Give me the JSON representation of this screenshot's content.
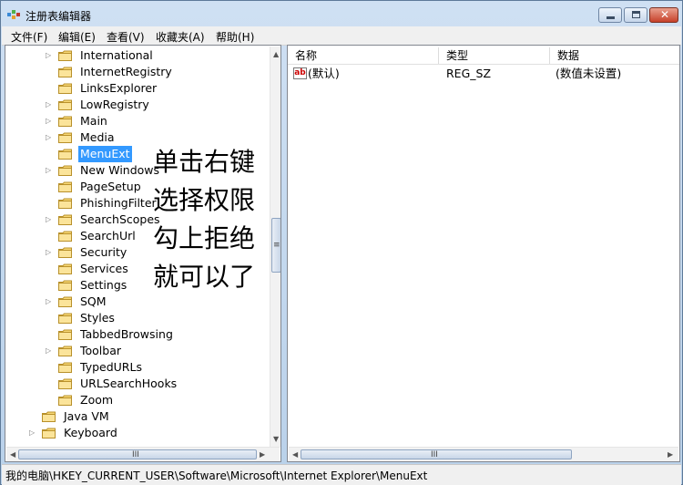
{
  "window": {
    "title": "注册表编辑器"
  },
  "menu": [
    "文件(F)",
    "编辑(E)",
    "查看(V)",
    "收藏夹(A)",
    "帮助(H)"
  ],
  "tree": [
    {
      "label": "International",
      "expander": true
    },
    {
      "label": "InternetRegistry",
      "expander": false
    },
    {
      "label": "LinksExplorer",
      "expander": false
    },
    {
      "label": "LowRegistry",
      "expander": true
    },
    {
      "label": "Main",
      "expander": true
    },
    {
      "label": "Media",
      "expander": true
    },
    {
      "label": "MenuExt",
      "expander": false,
      "selected": true
    },
    {
      "label": "New Windows",
      "expander": true
    },
    {
      "label": "PageSetup",
      "expander": false
    },
    {
      "label": "PhishingFilter",
      "expander": false
    },
    {
      "label": "SearchScopes",
      "expander": true
    },
    {
      "label": "SearchUrl",
      "expander": false
    },
    {
      "label": "Security",
      "expander": true
    },
    {
      "label": "Services",
      "expander": false
    },
    {
      "label": "Settings",
      "expander": false
    },
    {
      "label": "SQM",
      "expander": true
    },
    {
      "label": "Styles",
      "expander": false
    },
    {
      "label": "TabbedBrowsing",
      "expander": false
    },
    {
      "label": "Toolbar",
      "expander": true
    },
    {
      "label": "TypedURLs",
      "expander": false
    },
    {
      "label": "URLSearchHooks",
      "expander": false
    },
    {
      "label": "Zoom",
      "expander": false
    },
    {
      "label": "Java VM",
      "expander": false,
      "level": 1
    },
    {
      "label": "Keyboard",
      "expander": true,
      "level": 1
    }
  ],
  "list": {
    "headers": {
      "name": "名称",
      "type": "类型",
      "data": "数据"
    },
    "rows": [
      {
        "name": "(默认)",
        "type": "REG_SZ",
        "data": "(数值未设置)"
      }
    ]
  },
  "annotation": [
    "单击右键",
    "选择权限",
    "勾上拒绝",
    "就可以了"
  ],
  "status": {
    "path": "我的电脑\\HKEY_CURRENT_USER\\Software\\Microsoft\\Internet Explorer\\MenuExt"
  }
}
